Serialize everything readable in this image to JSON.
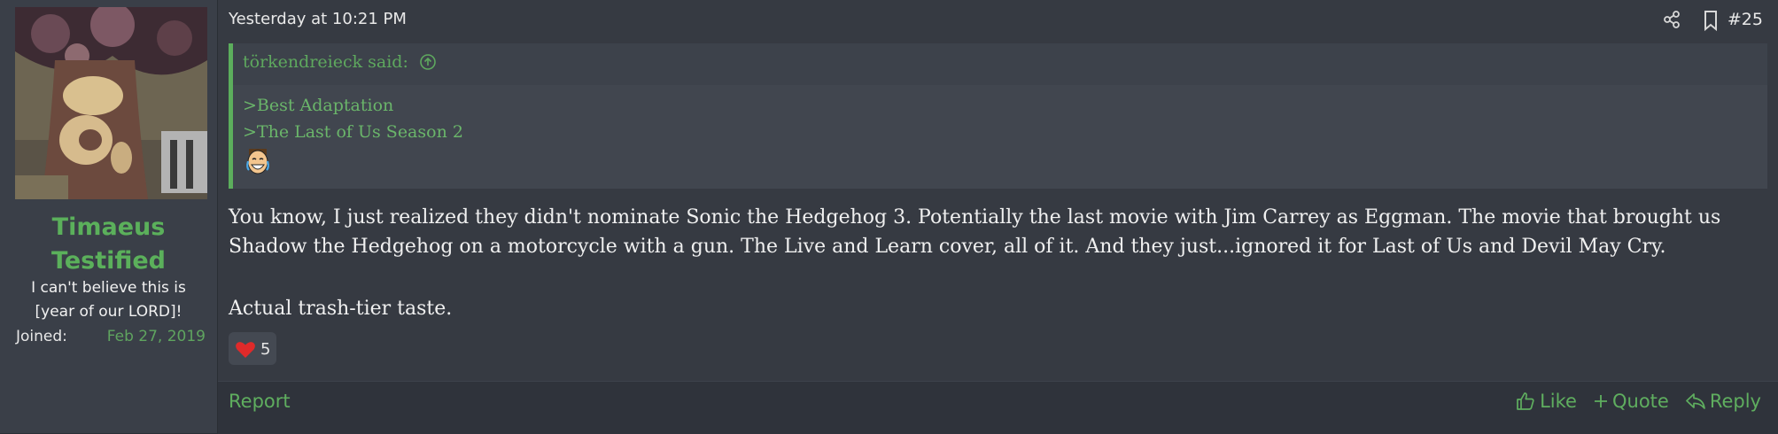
{
  "user": {
    "name_line1": "Timaeus",
    "name_line2": "Testified",
    "title_line1": "I can't believe this is",
    "title_line2": "[year of our LORD]!",
    "joined_label": "Joined:",
    "joined_value": "Feb 27, 2019"
  },
  "post": {
    "timestamp": "Yesterday at 10:21 PM",
    "number": "#25",
    "quote": {
      "author": "törkendreieck said:",
      "lines": [
        ">Best Adaptation",
        ">The Last of Us Season 2"
      ],
      "emoji": "laughing-crying-face"
    },
    "body": {
      "para1": "You know, I just realized they didn't nominate Sonic the Hedgehog 3. Potentially the last movie with Jim Carrey as Eggman. The movie that brought us Shadow the Hedgehog on a motorcycle with a gun. The Live and Learn cover, all of it. And they just...ignored it for Last of Us and Devil May Cry.",
      "para2": "Actual trash-tier taste."
    },
    "reaction": {
      "icon": "heart-icon",
      "count": "5"
    }
  },
  "footer": {
    "report": "Report",
    "like": "Like",
    "quote": "Quote",
    "reply": "Reply"
  },
  "colors": {
    "accent": "#5fae5f",
    "sidebar_bg": "#3a3f48",
    "main_bg": "#363a42",
    "quote_bg": "#41464f"
  },
  "icons": [
    "share-icon",
    "bookmark-icon",
    "arrow-up-circle-icon",
    "thumbs-up-icon",
    "plus-icon",
    "reply-icon"
  ]
}
